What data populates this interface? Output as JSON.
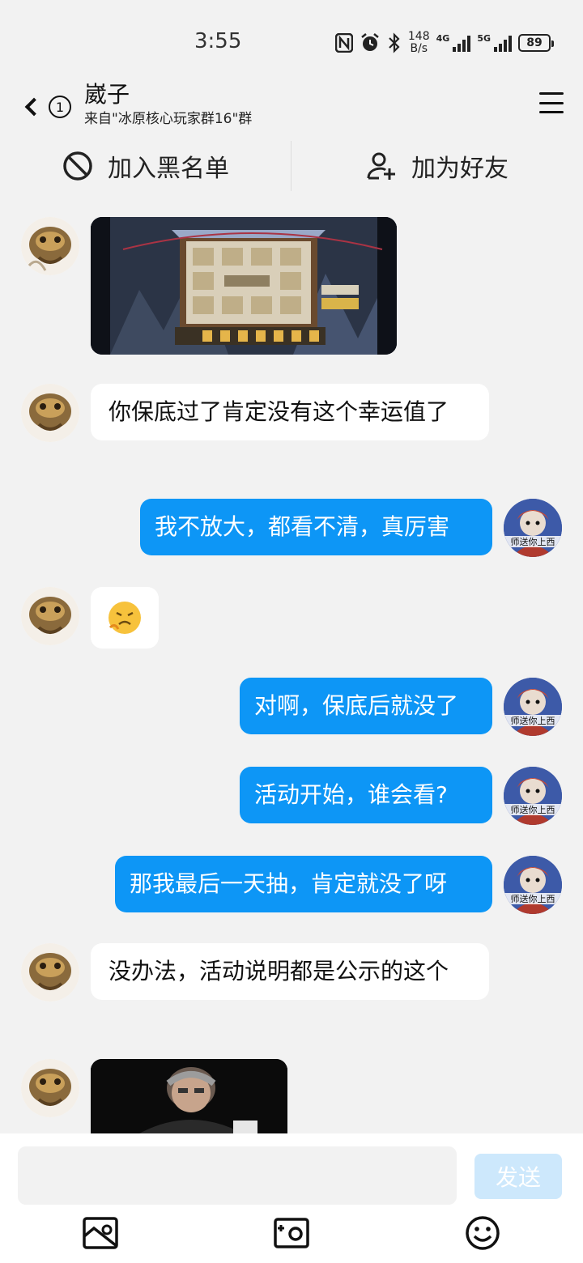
{
  "status_bar": {
    "time": "3:55",
    "net_speed_value": "148",
    "net_speed_unit": "B/s",
    "sim1": "4G",
    "sim2": "5G",
    "battery": "89",
    "icons": [
      "nfc-icon",
      "alarm-icon",
      "bluetooth-icon",
      "signal-icon",
      "battery-icon"
    ]
  },
  "header": {
    "unread_count": "1",
    "title": "崴子",
    "subtitle": "来自\"冰原核心玩家群16\"群",
    "menu_icon": "hamburger-menu-icon"
  },
  "actions": {
    "block_label": "加入黑名单",
    "add_friend_label": "加为好友"
  },
  "messages": [
    {
      "side": "left",
      "type": "image",
      "desc": "game-screenshot"
    },
    {
      "side": "left",
      "type": "text",
      "text": "你保底过了肯定没有这个幸运值了"
    },
    {
      "side": "right",
      "type": "text",
      "text": "我不放大，都看不清，真厉害"
    },
    {
      "side": "left",
      "type": "emoji",
      "text": "😤"
    },
    {
      "side": "right",
      "type": "text",
      "text": "对啊，保底后就没了"
    },
    {
      "side": "right",
      "type": "text",
      "text": "活动开始，谁会看?"
    },
    {
      "side": "right",
      "type": "text",
      "text": "那我最后一天抽，肯定就没了呀"
    },
    {
      "side": "left",
      "type": "text",
      "text": "没办法，活动说明都是公示的这个"
    },
    {
      "side": "left",
      "type": "image",
      "desc": "photo"
    }
  ],
  "right_avatar_caption": "师送你上西",
  "composer": {
    "placeholder": "",
    "send_label": "发送",
    "tools": [
      "image-icon",
      "camera-icon",
      "emoji-icon"
    ]
  },
  "colors": {
    "accent": "#0d96f6",
    "send_disabled": "#cde8fc",
    "background": "#f2f2f2"
  }
}
